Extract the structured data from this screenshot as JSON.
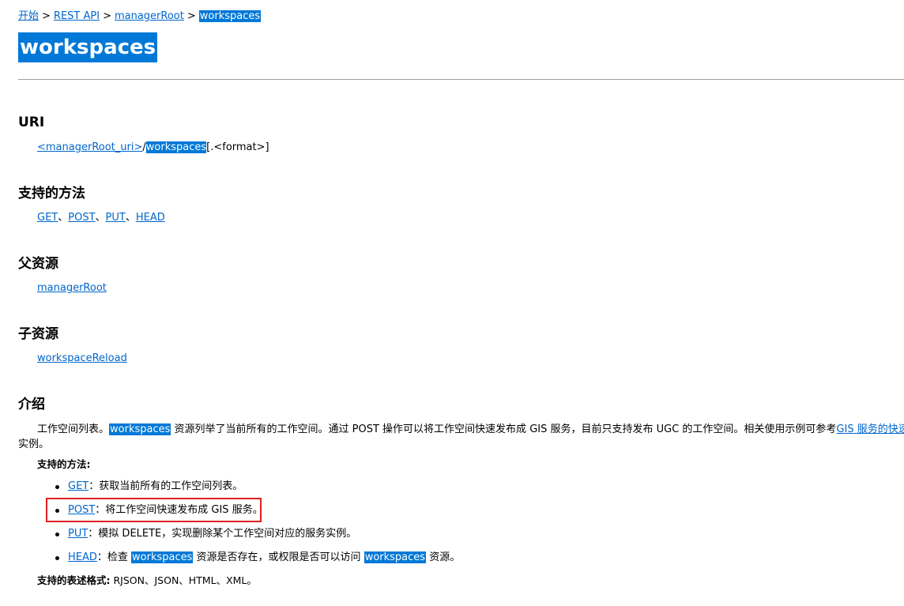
{
  "breadcrumb": {
    "items": [
      "开始",
      "REST API",
      "managerRoot",
      "workspaces"
    ],
    "sep": ">"
  },
  "title": "workspaces",
  "sections": {
    "uri": {
      "heading": "URI",
      "link": "<managerRoot_uri>",
      "slash": "/",
      "resource": "workspaces",
      "suffix": "[.<format>]"
    },
    "methods": {
      "heading": "支持的方法",
      "items": [
        "GET",
        "POST",
        "PUT",
        "HEAD"
      ],
      "sep": "、"
    },
    "parent": {
      "heading": "父资源",
      "link": "managerRoot"
    },
    "children": {
      "heading": "子资源",
      "link": "workspaceReload"
    },
    "intro": {
      "heading": "介绍",
      "text_before": "工作空间列表。",
      "highlight": "workspaces",
      "text_after": "资源列举了当前所有的工作空间。通过 POST 操作可以将工作空间快速发布成 GIS 服务，目前只支持发布 UGC 的工作空间。相关使用示例可参考",
      "link": "GIS 服务的快速发布",
      "line2": "实例。",
      "methods_label": "支持的方法:",
      "bullets": [
        {
          "method": "GET",
          "desc": "：获取当前所有的工作空间列表。"
        },
        {
          "method": "POST",
          "desc": "：将工作空间快速发布成 GIS 服务。"
        },
        {
          "method": "PUT",
          "desc": "：模拟 DELETE，实现删除某个工作空间对应的服务实例。"
        },
        {
          "method": "HEAD",
          "desc_a": "：检查 ",
          "hl_a": "workspaces",
          "desc_b": " 资源是否存在，或权限是否可以访问 ",
          "hl_b": "workspaces",
          "desc_c": " 资源。"
        }
      ],
      "formats_label": "支持的表述格式:",
      "formats": "RJSON、JSON、HTML、XML。"
    }
  },
  "colors": {
    "link": "#0066cc",
    "highlight_bg": "#0078d7",
    "highlight_text": "#ffffff",
    "annotation_box": "#e02020"
  }
}
